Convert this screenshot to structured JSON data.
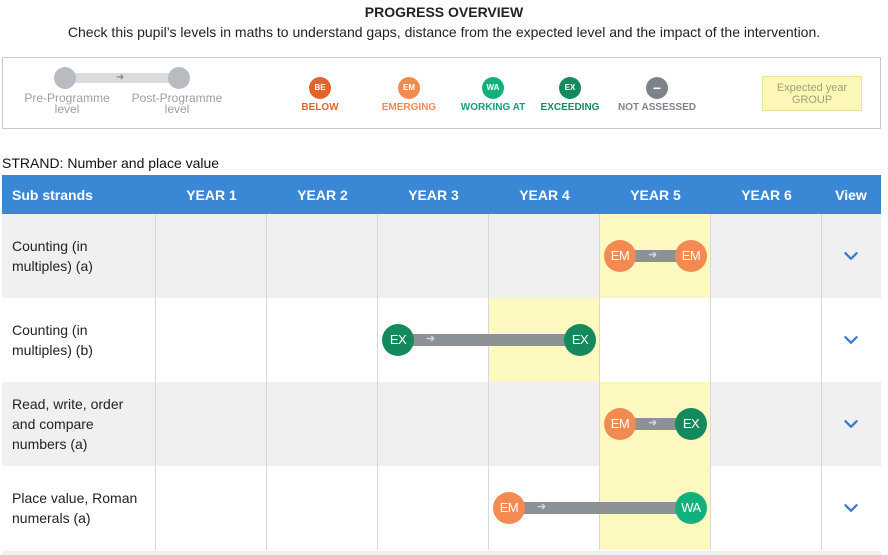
{
  "header": {
    "title": "PROGRESS OVERVIEW",
    "subtitle": "Check this pupil’s levels in maths to understand gaps, distance from the expected level and the impact of the intervention."
  },
  "legend": {
    "pre_label": "Pre-Programme level",
    "post_label": "Post-Programme level",
    "pre_label_lines": [
      "Pre-Programme",
      "level"
    ],
    "post_label_lines": [
      "Post-Programme",
      "level"
    ],
    "statuses": [
      {
        "code": "BE",
        "label": "BELOW",
        "color": "#e0652c",
        "text_color": "#e0652c"
      },
      {
        "code": "EM",
        "label": "EMERGING",
        "color": "#f28a52",
        "text_color": "#f28a52"
      },
      {
        "code": "WA",
        "label": "WORKING AT",
        "color": "#12b07d",
        "text_color": "#12a074"
      },
      {
        "code": "EX",
        "label": "EXCEEDING",
        "color": "#148a5c",
        "text_color": "#148a5c"
      },
      {
        "code": "−",
        "label": "NOT ASSESSED",
        "color": "#7d8389",
        "text_color": "#7d8389"
      }
    ],
    "expected_lines": [
      "Expected year",
      "GROUP"
    ]
  },
  "strand": "STRAND: Number and place value",
  "table": {
    "columns": [
      "Sub strands",
      "YEAR 1",
      "YEAR 2",
      "YEAR 3",
      "YEAR 4",
      "YEAR 5",
      "YEAR 6",
      "View"
    ],
    "rows": [
      {
        "label": "Counting (in multiples) (a)",
        "expected_year": 5,
        "pre": {
          "year": 5,
          "position": "start",
          "code": "EM"
        },
        "post": {
          "year": 5,
          "position": "end",
          "code": "EM"
        }
      },
      {
        "label": "Counting (in multiples) (b)",
        "expected_year": 4,
        "pre": {
          "year": 3,
          "position": "start",
          "code": "EX"
        },
        "post": {
          "year": 4,
          "position": "end",
          "code": "EX"
        }
      },
      {
        "label": "Read, write, order and compare numbers (a)",
        "expected_year": 5,
        "pre": {
          "year": 5,
          "position": "start",
          "code": "EM"
        },
        "post": {
          "year": 5,
          "position": "end",
          "code": "EX"
        }
      },
      {
        "label": "Place value, Roman numerals (a)",
        "expected_year": 5,
        "pre": {
          "year": 4,
          "position": "start",
          "code": "EM"
        },
        "post": {
          "year": 5,
          "position": "end",
          "code": "WA"
        }
      }
    ]
  },
  "colors": {
    "header_blue": "#3a87d6",
    "expected_yellow": "#fdf8c0",
    "track_gray": "#8c9196",
    "chevron_blue": "#3a7cc8",
    "EM": "#f28a52",
    "EX": "#148a5c",
    "WA": "#12b07d",
    "BE": "#e0652c"
  }
}
